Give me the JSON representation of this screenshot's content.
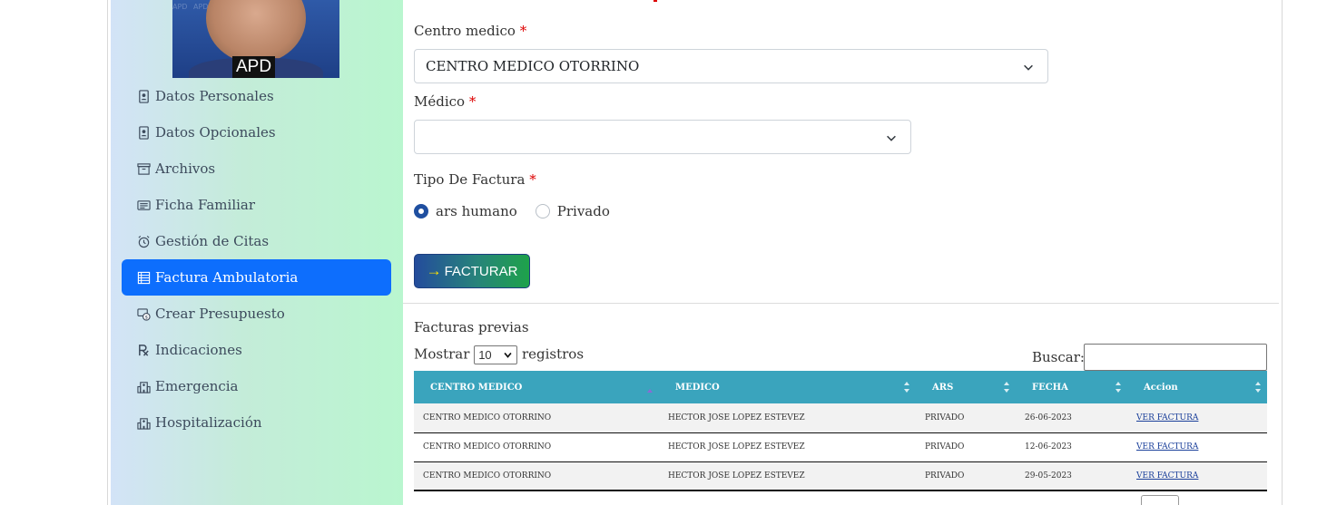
{
  "sidebar": {
    "avatar_badge": "APD",
    "avatar_watermark": "APD APD APD APD APD APD",
    "items": [
      {
        "label": "Datos Personales",
        "icon": "contact-card-icon"
      },
      {
        "label": "Datos Opcionales",
        "icon": "contact-card-icon"
      },
      {
        "label": "Archivos",
        "icon": "archive-box-icon"
      },
      {
        "label": "Ficha Familiar",
        "icon": "card-text-icon"
      },
      {
        "label": "Gestión de Citas",
        "icon": "alarm-clock-icon"
      },
      {
        "label": "Factura Ambulatoria",
        "icon": "ledger-icon",
        "active": true
      },
      {
        "label": "Crear Presupuesto",
        "icon": "cash-coin-icon"
      },
      {
        "label": "Indicaciones",
        "icon": "prescription-icon"
      },
      {
        "label": "Emergencia",
        "icon": "hospital-icon"
      },
      {
        "label": "Hospitalización",
        "icon": "hospital-icon"
      }
    ],
    "active_color": "#0d6efd"
  },
  "form": {
    "centro_label": "Centro medico",
    "centro_value": "CENTRO MEDICO OTORRINO",
    "medico_label": "Médico",
    "medico_value": "",
    "tipo_label": "Tipo De Factura",
    "required_mark": "*",
    "radio_options": [
      {
        "label": "ars humano",
        "checked": true
      },
      {
        "label": "Privado",
        "checked": false
      }
    ],
    "facturar_button": "FACTURAR",
    "facturar_arrow": "→"
  },
  "previas": {
    "title": "Facturas previas",
    "show_prefix": "Mostrar",
    "show_value": "10",
    "show_suffix": "registros",
    "search_label": "Buscar:",
    "search_value": "",
    "columns": [
      "CENTRO MEDICO",
      "MEDICO",
      "ARS",
      "FECHA",
      "Accion"
    ],
    "rows": [
      {
        "centro": "CENTRO MEDICO OTORRINO",
        "medico": "HECTOR JOSE LOPEZ ESTEVEZ",
        "ars": "PRIVADO",
        "fecha": "26-06-2023",
        "accion": "VER FACTURA"
      },
      {
        "centro": "CENTRO MEDICO OTORRINO",
        "medico": "HECTOR JOSE LOPEZ ESTEVEZ",
        "ars": "PRIVADO",
        "fecha": "12-06-2023",
        "accion": "VER FACTURA"
      },
      {
        "centro": "CENTRO MEDICO OTORRINO",
        "medico": "HECTOR JOSE LOPEZ ESTEVEZ",
        "ars": "PRIVADO",
        "fecha": "29-05-2023",
        "accion": "VER FACTURA"
      }
    ],
    "header_color": "#3aa4bd"
  }
}
